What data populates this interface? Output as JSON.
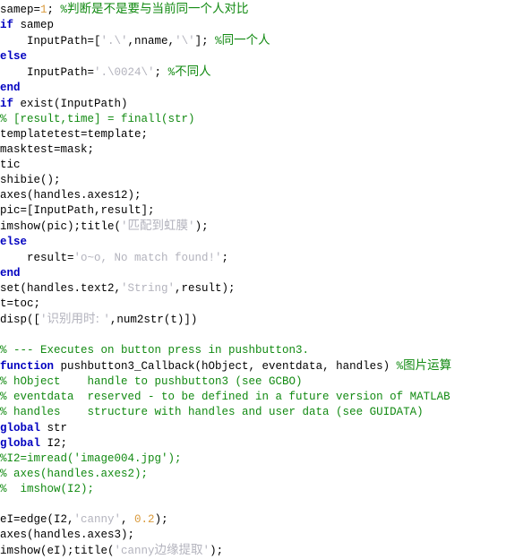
{
  "editor": {
    "language": "matlab",
    "colors": {
      "plain": "#000000",
      "keyword": "#0000c0",
      "comment": "#128a12",
      "string": "#b3b3bd",
      "number": "#d99a3c",
      "background": "#ffffff"
    }
  },
  "code": {
    "lines": [
      {
        "tokens": [
          {
            "t": "samep=",
            "c": "plain"
          },
          {
            "t": "1",
            "c": "number"
          },
          {
            "t": "; ",
            "c": "plain"
          },
          {
            "t": "%",
            "c": "comment"
          },
          {
            "t": "判断是不是要与当前同一个人对比",
            "c": "comment",
            "cjk": true
          }
        ]
      },
      {
        "tokens": [
          {
            "t": "if",
            "c": "keyword"
          },
          {
            "t": " samep",
            "c": "plain"
          }
        ]
      },
      {
        "tokens": [
          {
            "t": "    InputPath=[",
            "c": "plain"
          },
          {
            "t": "'.\\'",
            "c": "string"
          },
          {
            "t": ",nname,",
            "c": "plain"
          },
          {
            "t": "'\\'",
            "c": "string"
          },
          {
            "t": "]; ",
            "c": "plain"
          },
          {
            "t": "%",
            "c": "comment"
          },
          {
            "t": "同一个人",
            "c": "comment",
            "cjk": true
          }
        ]
      },
      {
        "tokens": [
          {
            "t": "else",
            "c": "keyword"
          }
        ]
      },
      {
        "tokens": [
          {
            "t": "    InputPath=",
            "c": "plain"
          },
          {
            "t": "'.\\0024\\'",
            "c": "string"
          },
          {
            "t": "; ",
            "c": "plain"
          },
          {
            "t": "%",
            "c": "comment"
          },
          {
            "t": "不同人",
            "c": "comment",
            "cjk": true
          }
        ]
      },
      {
        "tokens": [
          {
            "t": "end",
            "c": "keyword"
          }
        ]
      },
      {
        "tokens": [
          {
            "t": "if",
            "c": "keyword"
          },
          {
            "t": " exist(InputPath)",
            "c": "plain"
          }
        ]
      },
      {
        "tokens": [
          {
            "t": "% [result,time] = finall(str)",
            "c": "comment"
          }
        ]
      },
      {
        "tokens": [
          {
            "t": "templatetest=template;",
            "c": "plain"
          }
        ]
      },
      {
        "tokens": [
          {
            "t": "masktest=mask;",
            "c": "plain"
          }
        ]
      },
      {
        "tokens": [
          {
            "t": "tic",
            "c": "plain"
          }
        ]
      },
      {
        "tokens": [
          {
            "t": "shibie();",
            "c": "plain"
          }
        ]
      },
      {
        "tokens": [
          {
            "t": "axes(handles.axes12);",
            "c": "plain"
          }
        ]
      },
      {
        "tokens": [
          {
            "t": "pic=[InputPath,result];",
            "c": "plain"
          }
        ]
      },
      {
        "tokens": [
          {
            "t": "imshow(pic);title(",
            "c": "plain"
          },
          {
            "t": "'",
            "c": "string"
          },
          {
            "t": "匹配到虹膜",
            "c": "string",
            "cjk": true
          },
          {
            "t": "'",
            "c": "string"
          },
          {
            "t": ");",
            "c": "plain"
          }
        ]
      },
      {
        "tokens": [
          {
            "t": "else",
            "c": "keyword"
          }
        ]
      },
      {
        "tokens": [
          {
            "t": "    result=",
            "c": "plain"
          },
          {
            "t": "'o~o, No match found!'",
            "c": "string"
          },
          {
            "t": ";",
            "c": "plain"
          }
        ]
      },
      {
        "tokens": [
          {
            "t": "end",
            "c": "keyword"
          }
        ]
      },
      {
        "tokens": [
          {
            "t": "set(handles.text2,",
            "c": "plain"
          },
          {
            "t": "'String'",
            "c": "string"
          },
          {
            "t": ",result);",
            "c": "plain"
          }
        ]
      },
      {
        "tokens": [
          {
            "t": "t=toc;",
            "c": "plain"
          }
        ]
      },
      {
        "tokens": [
          {
            "t": "disp([",
            "c": "plain"
          },
          {
            "t": "'",
            "c": "string"
          },
          {
            "t": "识别用时: ",
            "c": "string",
            "cjk": true
          },
          {
            "t": "'",
            "c": "string"
          },
          {
            "t": ",num2str(t)])",
            "c": "plain"
          }
        ]
      },
      {
        "tokens": []
      },
      {
        "tokens": [
          {
            "t": "% --- Executes on button press in pushbutton3.",
            "c": "comment"
          }
        ]
      },
      {
        "tokens": [
          {
            "t": "function",
            "c": "keyword"
          },
          {
            "t": " pushbutton3_Callback(hObject, eventdata, handles) ",
            "c": "plain"
          },
          {
            "t": "%",
            "c": "comment"
          },
          {
            "t": "图片运算",
            "c": "comment",
            "cjk": true
          }
        ]
      },
      {
        "tokens": [
          {
            "t": "% hObject    handle to pushbutton3 (see GCBO)",
            "c": "comment"
          }
        ]
      },
      {
        "tokens": [
          {
            "t": "% eventdata  reserved - to be defined in a future version of MATLAB",
            "c": "comment"
          }
        ]
      },
      {
        "tokens": [
          {
            "t": "% handles    structure with handles and user data (see GUIDATA)",
            "c": "comment"
          }
        ]
      },
      {
        "tokens": [
          {
            "t": "global",
            "c": "keyword"
          },
          {
            "t": " str",
            "c": "plain"
          }
        ]
      },
      {
        "tokens": [
          {
            "t": "global",
            "c": "keyword"
          },
          {
            "t": " I2;",
            "c": "plain"
          }
        ]
      },
      {
        "tokens": [
          {
            "t": "%I2=imread('image004.jpg');",
            "c": "comment"
          }
        ]
      },
      {
        "tokens": [
          {
            "t": "% axes(handles.axes2);",
            "c": "comment"
          }
        ]
      },
      {
        "tokens": [
          {
            "t": "%  imshow(I2);",
            "c": "comment"
          }
        ]
      },
      {
        "tokens": []
      },
      {
        "tokens": [
          {
            "t": "eI=edge(I2,",
            "c": "plain"
          },
          {
            "t": "'canny'",
            "c": "string"
          },
          {
            "t": ", ",
            "c": "plain"
          },
          {
            "t": "0.2",
            "c": "number"
          },
          {
            "t": ");",
            "c": "plain"
          }
        ]
      },
      {
        "tokens": [
          {
            "t": "axes(handles.axes3);",
            "c": "plain"
          }
        ]
      },
      {
        "tokens": [
          {
            "t": "imshow(eI);title(",
            "c": "plain"
          },
          {
            "t": "'canny",
            "c": "string"
          },
          {
            "t": "边缘提取",
            "c": "string",
            "cjk": true
          },
          {
            "t": "'",
            "c": "string"
          },
          {
            "t": ");",
            "c": "plain"
          }
        ]
      }
    ]
  }
}
